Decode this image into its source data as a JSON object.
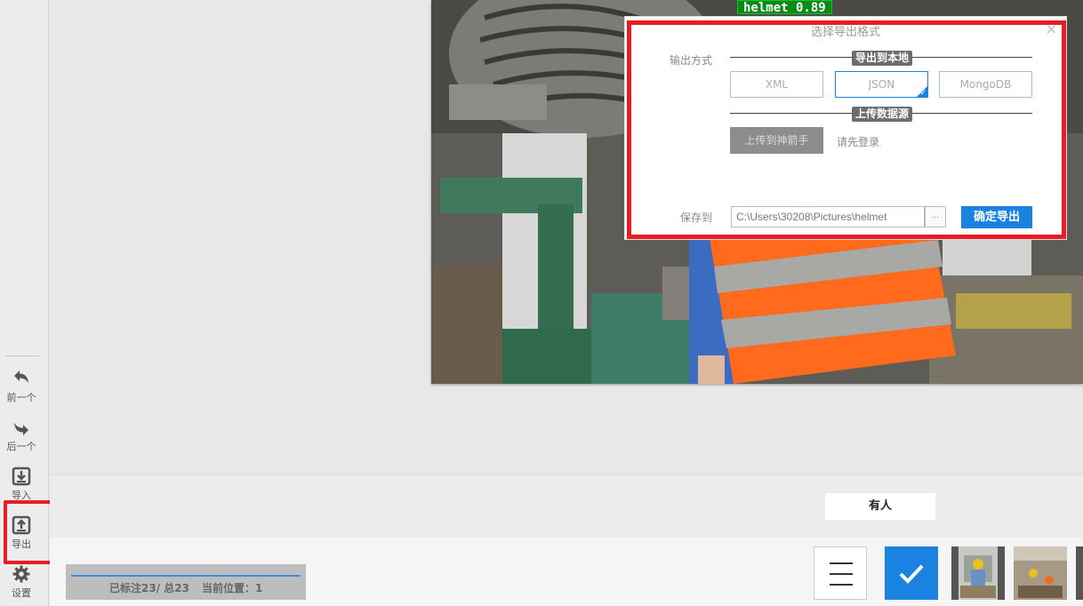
{
  "sidebar": {
    "items": [
      {
        "label": "前一个",
        "icon": "undo-arrow-icon"
      },
      {
        "label": "后一个",
        "icon": "redo-arrow-icon"
      },
      {
        "label": "导入",
        "icon": "import-icon"
      },
      {
        "label": "导出",
        "icon": "export-icon"
      },
      {
        "label": "设置",
        "icon": "gear-icon"
      }
    ]
  },
  "detection": {
    "label": "helmet 0.89"
  },
  "dialog": {
    "title": "选择导出格式",
    "output_label": "输出方式",
    "local_section": "导出到本地",
    "formats": [
      "XML",
      "JSON",
      "MongoDB"
    ],
    "selected_format": "JSON",
    "upload_section": "上传数据源",
    "upload_button": "上传到神箭手",
    "login_hint": "请先登录",
    "save_label": "保存到",
    "save_path": "C:\\Users\\30208\\Pictures\\helmet",
    "browse_button": "...",
    "confirm_button": "确定导出",
    "close_icon": "×"
  },
  "label_tag": "有人",
  "status": {
    "annotated": "已标注23/ 总23",
    "position": "当前位置：1"
  },
  "colors": {
    "accent": "#1a82e0",
    "highlight": "#e81c25",
    "detection": "#0a8a16"
  }
}
